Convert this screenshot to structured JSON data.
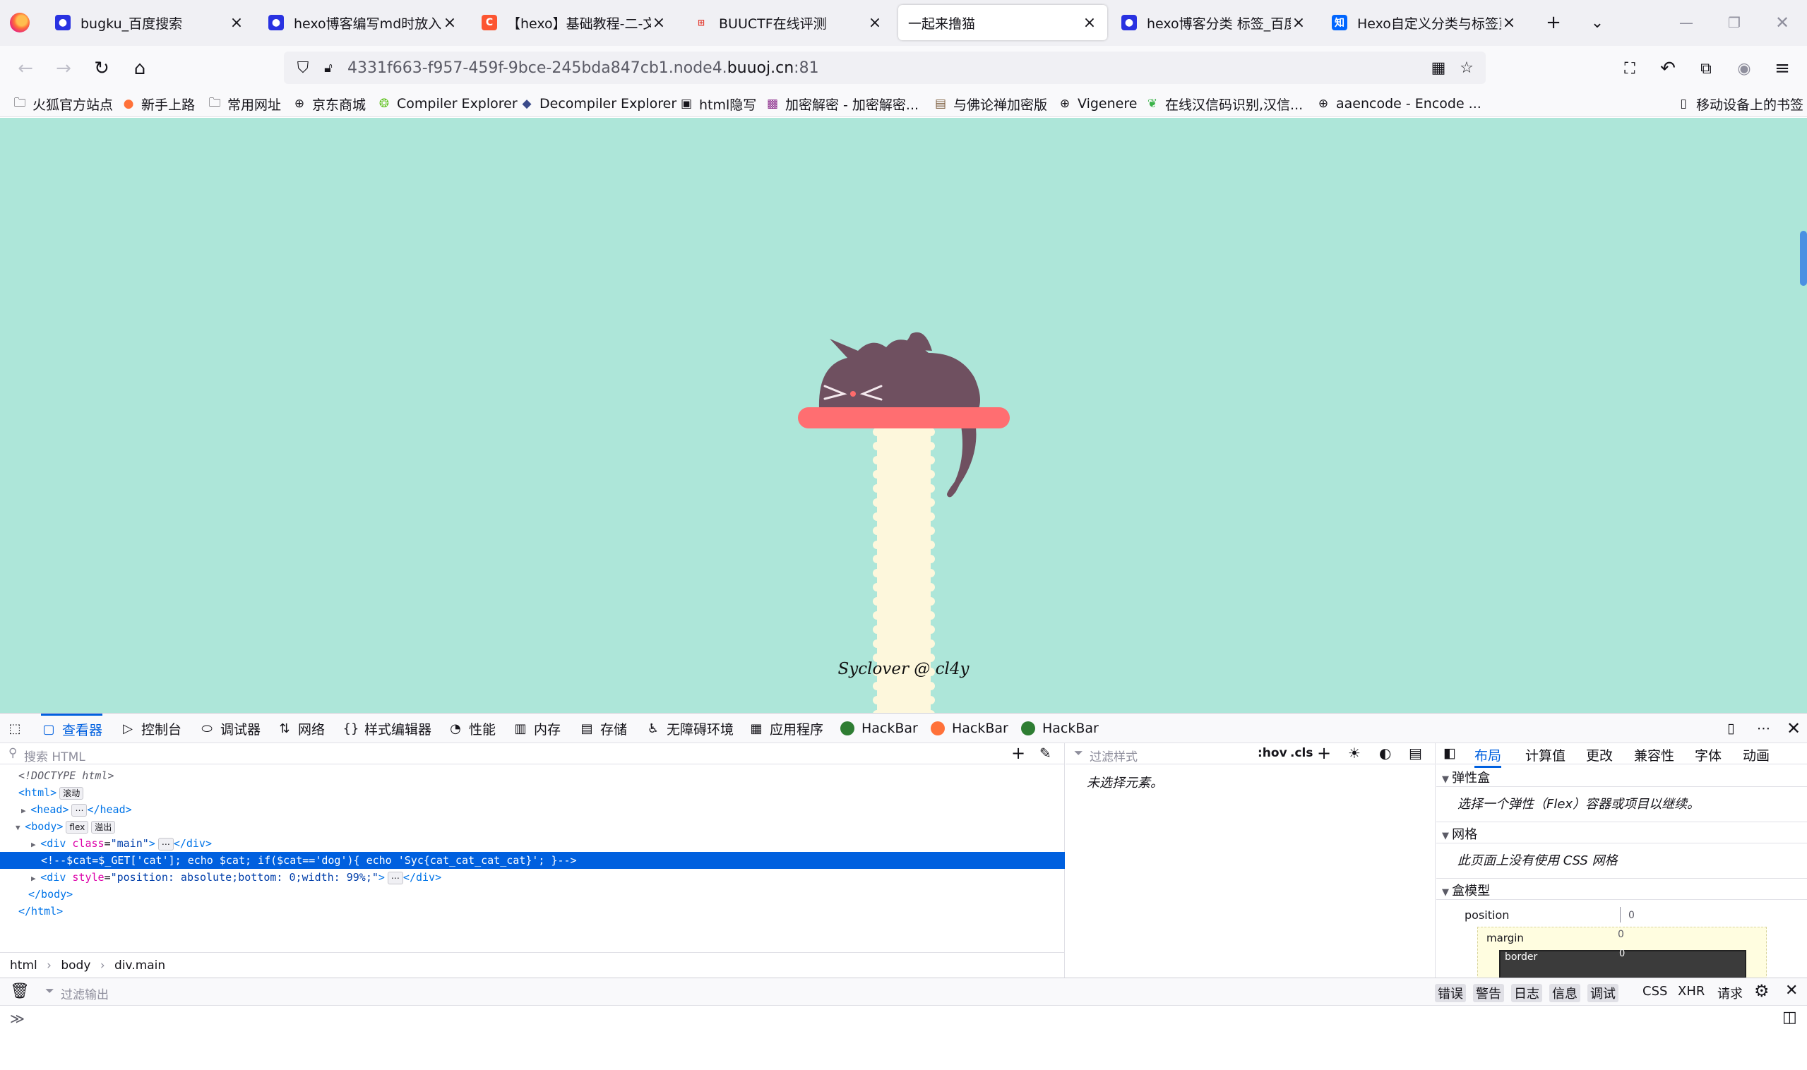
{
  "tabs": [
    {
      "title": "bugku_百度搜索",
      "icon": "baidu-paw-icon",
      "color": "#2932e1"
    },
    {
      "title": "hexo博客编写md时放入图片",
      "icon": "baidu-paw-icon",
      "color": "#2932e1"
    },
    {
      "title": "【hexo】基础教程-二-文章",
      "icon": "csdn-c-icon",
      "color": "#fc5531"
    },
    {
      "title": "BUUCTF在线评测",
      "icon": "buuctf-icon",
      "color": "#e33e33"
    },
    {
      "title": "一起来撸猫",
      "icon": "",
      "color": ""
    },
    {
      "title": "hexo博客分类 标签_百度搜索",
      "icon": "baidu-paw-icon",
      "color": "#2932e1"
    },
    {
      "title": "Hexo自定义分类与标签页",
      "icon": "zhihu-icon",
      "color": "#0066ff"
    }
  ],
  "url": {
    "prefix": "4331f663-f957-459f-9bce-245bda847cb1.node4.",
    "domain": "buuoj.cn",
    "suffix": ":81"
  },
  "bookmarks": [
    {
      "label": "火狐官方站点",
      "icon": "folder-icon"
    },
    {
      "label": "新手上路",
      "icon": "firefox-icon"
    },
    {
      "label": "常用网址",
      "icon": "folder-icon"
    },
    {
      "label": "京东商城",
      "icon": "globe-icon"
    },
    {
      "label": "Compiler Explorer",
      "icon": "compiler-explorer-icon"
    },
    {
      "label": "Decompiler Explorer",
      "icon": "decompiler-explorer-icon"
    },
    {
      "label": "html隐写",
      "icon": "image-icon"
    },
    {
      "label": "加密解密 - 加密解密...",
      "icon": "crypto-icon"
    },
    {
      "label": "与佛论禅加密版",
      "icon": "buddha-icon"
    },
    {
      "label": "Vigenere",
      "icon": "globe-icon"
    },
    {
      "label": "在线汉信码识别,汉信...",
      "icon": "leaf-icon"
    },
    {
      "label": "aaencode - Encode ...",
      "icon": "globe-icon"
    }
  ],
  "mobile_bookmarks": "移动设备上的书签",
  "page": {
    "footer": "Syclover @ cl4y"
  },
  "devtools": {
    "tools": [
      {
        "label": "查看器",
        "icon": "inspector-icon",
        "selected": true
      },
      {
        "label": "控制台",
        "icon": "console-icon"
      },
      {
        "label": "调试器",
        "icon": "debugger-icon"
      },
      {
        "label": "网络",
        "icon": "network-icon"
      },
      {
        "label": "样式编辑器",
        "icon": "style-editor-icon"
      },
      {
        "label": "性能",
        "icon": "performance-icon"
      },
      {
        "label": "内存",
        "icon": "memory-icon"
      },
      {
        "label": "存储",
        "icon": "storage-icon"
      },
      {
        "label": "无障碍环境",
        "icon": "accessibility-icon"
      },
      {
        "label": "应用程序",
        "icon": "application-icon"
      },
      {
        "label": "HackBar",
        "icon": "hackbar-icon"
      },
      {
        "label": "HackBar",
        "icon": "hackbar-icon"
      },
      {
        "label": "HackBar",
        "icon": "hackbar-icon"
      }
    ],
    "search_placeholder": "搜索 HTML",
    "markup": {
      "doctype": "<!DOCTYPE html>",
      "html_open": "<html>",
      "html_badge": "滚动",
      "head": "<head>",
      "head_close": "</head>",
      "body_open": "<body>",
      "body_badge_flex": "flex",
      "body_badge_overflow": "溢出",
      "div_main_tag": "<div",
      "div_main_attr": "class",
      "div_main_val": "\"main\"",
      "div_close": "</div>",
      "comment": "<!--$cat=$_GET['cat']; echo $cat; if($cat=='dog'){ echo 'Syc{cat_cat_cat_cat}'; }-->",
      "div2_tag": "<div",
      "div2_attr": "style",
      "div2_val": "\"position: absolute;bottom: 0;width: 99%;\"",
      "body_close": "</body>",
      "html_close": "</html>"
    },
    "breadcrumb": [
      "html",
      "body",
      "div.main"
    ],
    "rules": {
      "filter_placeholder": "过滤样式",
      "hov": ":hov",
      "cls": ".cls",
      "empty": "未选择元素。"
    },
    "layout_tabs": [
      "布局",
      "计算值",
      "更改",
      "兼容性",
      "字体",
      "动画"
    ],
    "layout": {
      "flex_title": "弹性盒",
      "flex_body": "选择一个弹性（Flex）容器或项目以继续。",
      "grid_title": "网格",
      "grid_body": "此页面上没有使用 CSS 网格",
      "box_title": "盒模型",
      "position_label": "position",
      "position_value": "0",
      "margin_label": "margin",
      "margin_value": "0",
      "border_label": "border",
      "border_value": "0"
    },
    "console": {
      "filter_placeholder": "过滤输出",
      "levels": [
        "错误",
        "警告",
        "日志",
        "信息",
        "调试"
      ],
      "types": [
        "CSS",
        "XHR",
        "请求"
      ]
    }
  }
}
